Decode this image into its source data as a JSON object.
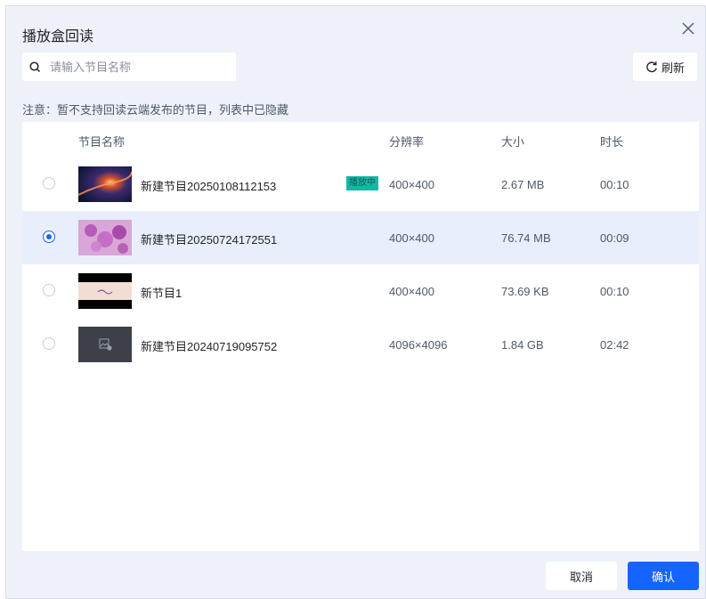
{
  "dialog": {
    "title": "播放盒回读",
    "search_placeholder": "请输入节目名称",
    "refresh_label": "刷新",
    "notice": "注意：暂不支持回读云端发布的节目，列表中已隐藏",
    "columns": {
      "name": "节目名称",
      "resolution": "分辨率",
      "size": "大小",
      "duration": "时长"
    },
    "rows": [
      {
        "name": "新建节目20250108112153",
        "badge": "播放中",
        "resolution": "400×400",
        "size": "2.67 MB",
        "duration": "00:10",
        "selected": false
      },
      {
        "name": "新建节目20250724172551",
        "badge": "",
        "resolution": "400×400",
        "size": "76.74 MB",
        "duration": "00:09",
        "selected": true
      },
      {
        "name": "新节目1",
        "badge": "",
        "resolution": "400×400",
        "size": "73.69 KB",
        "duration": "00:10",
        "selected": false
      },
      {
        "name": "新建节目20240719095752",
        "badge": "",
        "resolution": "4096×4096",
        "size": "1.84 GB",
        "duration": "02:42",
        "selected": false
      }
    ],
    "cancel_label": "取消",
    "confirm_label": "确认"
  },
  "colors": {
    "accent": "#1664ff",
    "badge": "#14b8a6",
    "dialog_bg": "#eef2f8",
    "selected_row": "#e8eefb"
  }
}
